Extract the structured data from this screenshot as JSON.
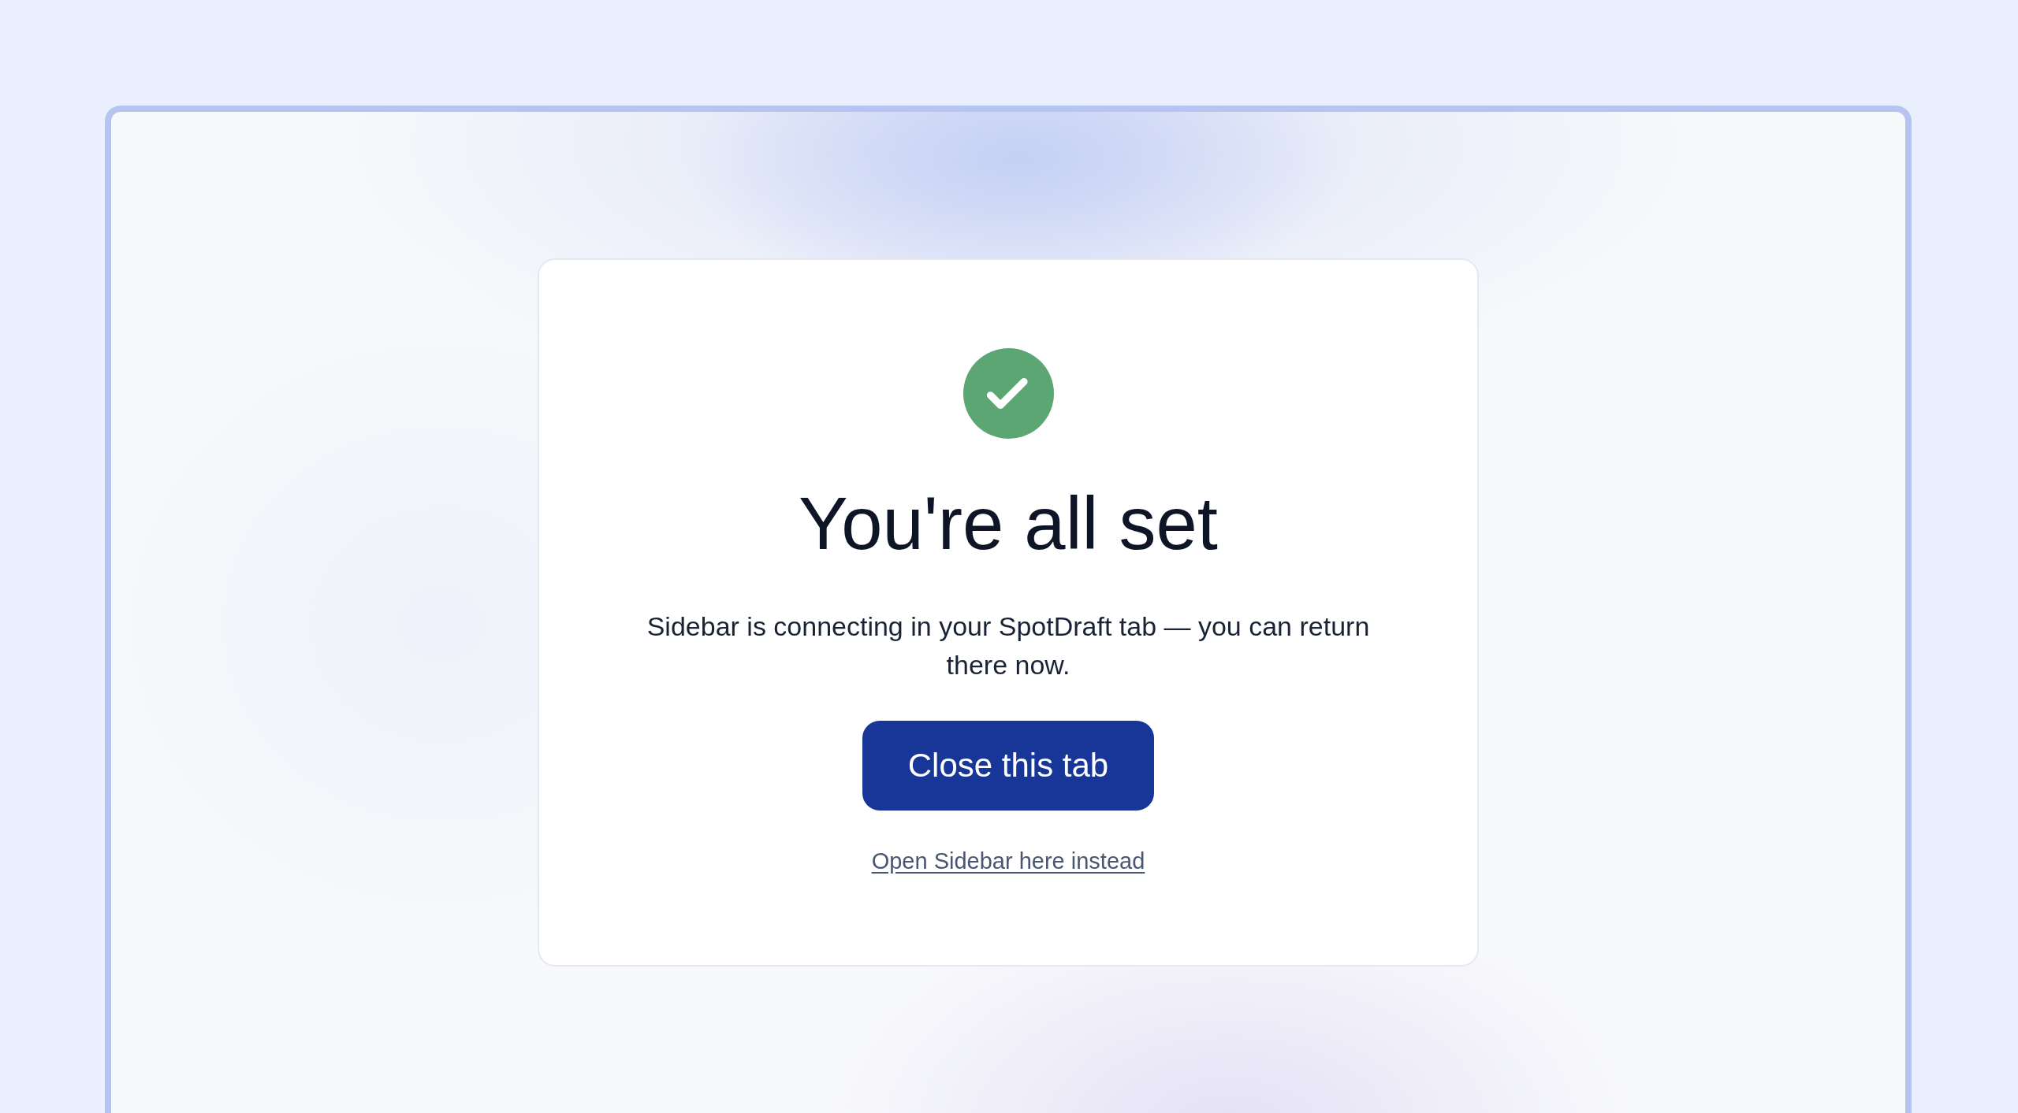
{
  "card": {
    "heading": "You're all set",
    "message": "Sidebar is connecting in your SpotDraft tab — you can return there now.",
    "primary_button": {
      "label": "Close this tab"
    },
    "secondary_link": {
      "label": "Open Sidebar here instead"
    }
  }
}
